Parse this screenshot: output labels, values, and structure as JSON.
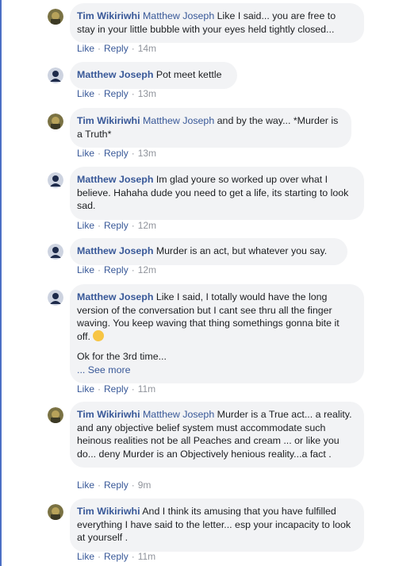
{
  "actions": {
    "like": "Like",
    "reply": "Reply",
    "dot": "·"
  },
  "comments": [
    {
      "author": "Tim Wikiriwhi",
      "mention": "Matthew Joseph",
      "text": " Like I said... you are free to stay in your little bubble with your eyes held tightly closed...",
      "time": "14m",
      "avatar": "tim"
    },
    {
      "author": "Matthew Joseph",
      "mention": "",
      "text": " Pot meet kettle",
      "time": "13m",
      "avatar": "matthew"
    },
    {
      "author": "Tim Wikiriwhi",
      "mention": "Matthew Joseph",
      "text": " and by the way... *Murder is a Truth*",
      "time": "13m",
      "avatar": "tim"
    },
    {
      "author": "Matthew Joseph",
      "mention": "",
      "text": " Im glad youre so worked up over what I believe. Hahaha dude you need to get a life, its starting to look sad.",
      "time": "12m",
      "avatar": "matthew"
    },
    {
      "author": "Matthew Joseph",
      "mention": "",
      "text": " Murder is an act, but whatever you say.",
      "time": "12m",
      "avatar": "matthew"
    },
    {
      "author": "Matthew Joseph",
      "mention": "",
      "text": " Like I said, I totally would have the long version of the conversation but I cant see thru all the finger waving. You keep waving that thing somethings gonna bite it off.",
      "text2": "Ok for the 3rd time...",
      "see_more": "... See more",
      "time": "11m",
      "avatar": "matthew"
    },
    {
      "author": "Tim Wikiriwhi",
      "mention": "Matthew Joseph",
      "text": " Murder is a True act... a reality. and any objective belief system must accommodate such heinous realities not be all Peaches and cream ... or like you do... deny Murder is an Objectively henious reality...a fact .",
      "time": "9m",
      "avatar": "tim"
    },
    {
      "author": "Tim Wikiriwhi",
      "mention": "",
      "text": " And I think its amusing that you have fulfilled everything I have said to the letter... esp your incapacity to look at yourself .",
      "time": "11m",
      "avatar": "tim"
    }
  ]
}
